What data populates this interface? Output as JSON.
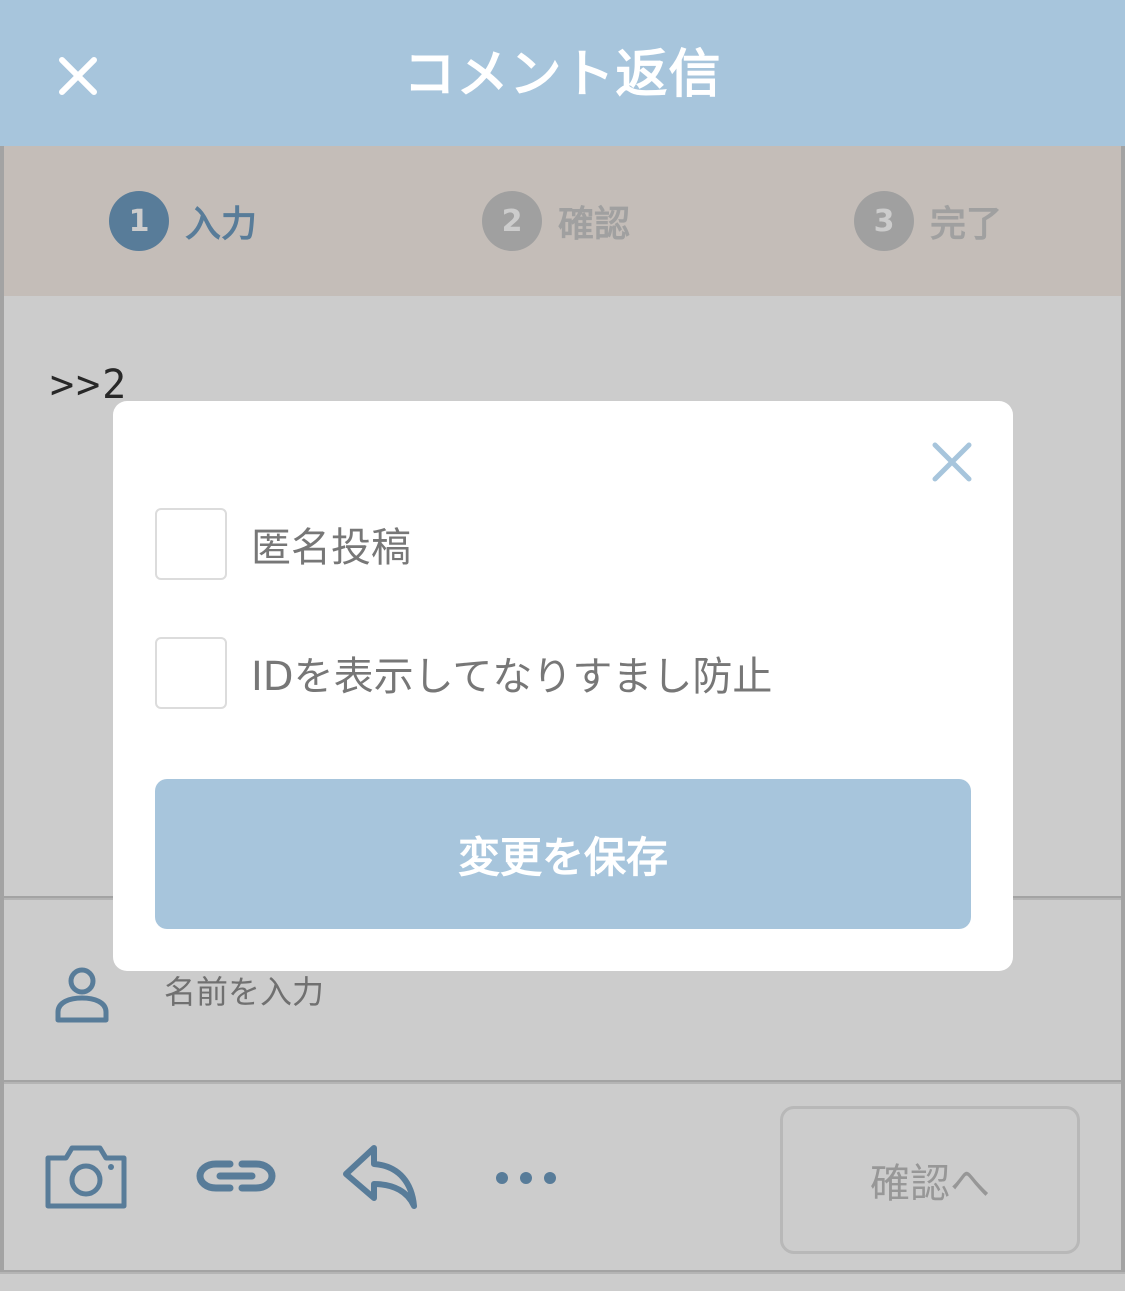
{
  "header": {
    "title": "コメント返信"
  },
  "steps": [
    {
      "num": "1",
      "label": "入力"
    },
    {
      "num": "2",
      "label": "確認"
    },
    {
      "num": "3",
      "label": "完了"
    }
  ],
  "editor": {
    "value": ">>2"
  },
  "name_field": {
    "placeholder": "名前を入力"
  },
  "toolbar": {
    "confirm_label": "確認へ"
  },
  "modal": {
    "options": [
      {
        "label": "匿名投稿",
        "checked": false
      },
      {
        "label": "IDを表示してなりすまし防止",
        "checked": false
      }
    ],
    "save_label": "変更を保存"
  },
  "colors": {
    "accent": "#a7c5dc",
    "active_step": "#6f9cc0",
    "icon": "#6f9cc0"
  }
}
